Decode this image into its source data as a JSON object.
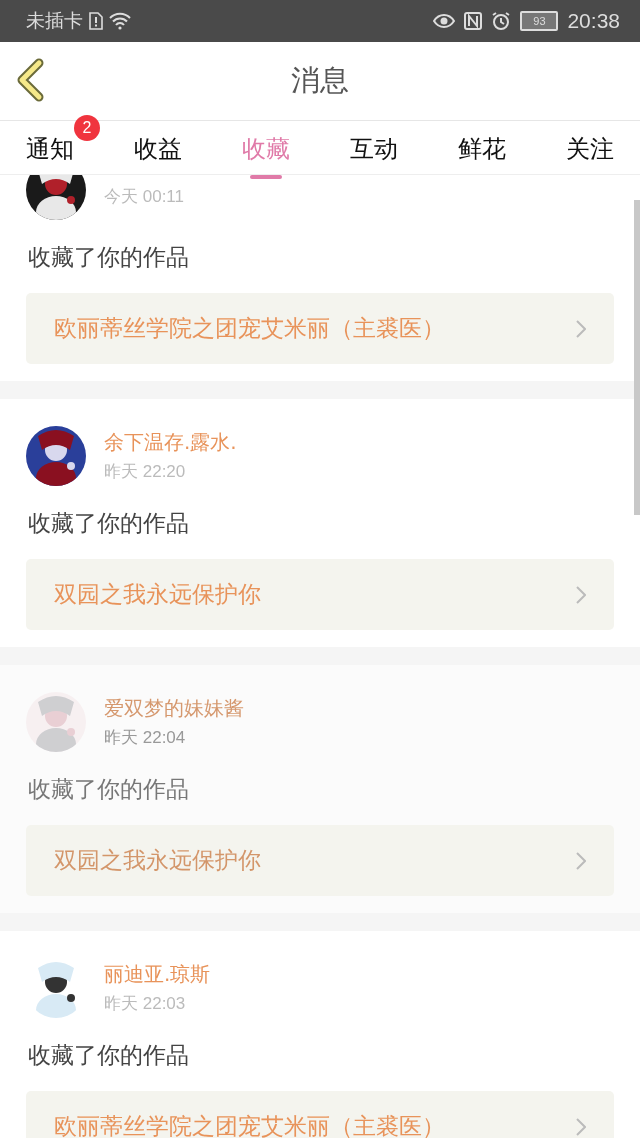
{
  "status_bar": {
    "carrier": "未插卡",
    "battery": "93",
    "time": "20:38"
  },
  "header": {
    "title": "消息"
  },
  "tabs": [
    {
      "label": "通知",
      "selected": false,
      "badge": "2"
    },
    {
      "label": "收益",
      "selected": false
    },
    {
      "label": "收藏",
      "selected": true
    },
    {
      "label": "互动",
      "selected": false
    },
    {
      "label": "鲜花",
      "selected": false
    },
    {
      "label": "关注",
      "selected": false
    }
  ],
  "messages": [
    {
      "time": "今天 00:11",
      "action": "收藏了你的作品",
      "work": "欧丽蒂丝学院之团宠艾米丽（主裘医）",
      "faded": false
    },
    {
      "user": "余下温存.露水.",
      "time": "昨天 22:20",
      "action": "收藏了你的作品",
      "work": "双园之我永远保护你",
      "faded": false
    },
    {
      "user": "爱双梦的妹妹酱",
      "time": "昨天 22:04",
      "action": "收藏了你的作品",
      "work": "双园之我永远保护你",
      "faded": true
    },
    {
      "user": "丽迪亚.琼斯",
      "time": "昨天 22:03",
      "action": "收藏了你的作品",
      "work": "欧丽蒂丝学院之团宠艾米丽（主裘医）",
      "faded": false
    }
  ]
}
